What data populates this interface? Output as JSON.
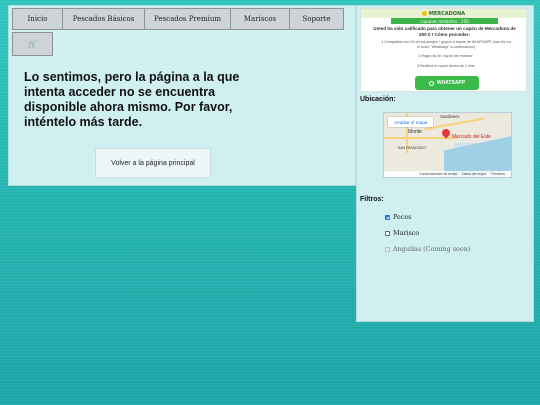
{
  "nav": {
    "items": [
      "Inicio",
      "Pescados Básicos",
      "Pescados Premium",
      "Mariscos",
      "Soporte"
    ],
    "cart_icon": "🛒"
  },
  "main": {
    "message": "Lo sentimos, pero la página a la que intenta acceder no se encuentra disponible ahora mismo. Por favor, inténtelo más tarde.",
    "back_button": "Volver a la página principal"
  },
  "promo": {
    "brand": "MERCADONA",
    "bar_text": "cupones restantes : 250",
    "headline": "Usted ha sido calificado para obtener un cupón de Mercadona de 250 € ! Cómo proceder:",
    "step1": "1.Compártelo con 20 de tus amigos / grupos a través de WHATSAPP (haz clic en el icono \"WhatsApp\" a continuación)",
    "step2": "2.Haga clic en \"cupón de reclamo\"",
    "step3": "3.Recibirá el cupón dentro de 2 días",
    "whatsapp_label": "WHATSAPP",
    "accent": "#3bba49"
  },
  "map_section": {
    "title": "Ubicación:",
    "enlarge": "Ampliar el mapa",
    "place_label": "Mercado del Este",
    "labels": [
      "Sardinero",
      "Monte",
      "SAN FRANCISCO"
    ],
    "footer": [
      "Combinaciones de teclas",
      "Datos del mapa",
      "Términos"
    ]
  },
  "filters": {
    "title": "Filtros:",
    "options": [
      {
        "label": "Peces",
        "checked": true,
        "disabled": false
      },
      {
        "label": "Marisco",
        "checked": false,
        "disabled": false
      },
      {
        "label": "Anguilas (Coming soon)",
        "checked": false,
        "disabled": true
      }
    ]
  }
}
